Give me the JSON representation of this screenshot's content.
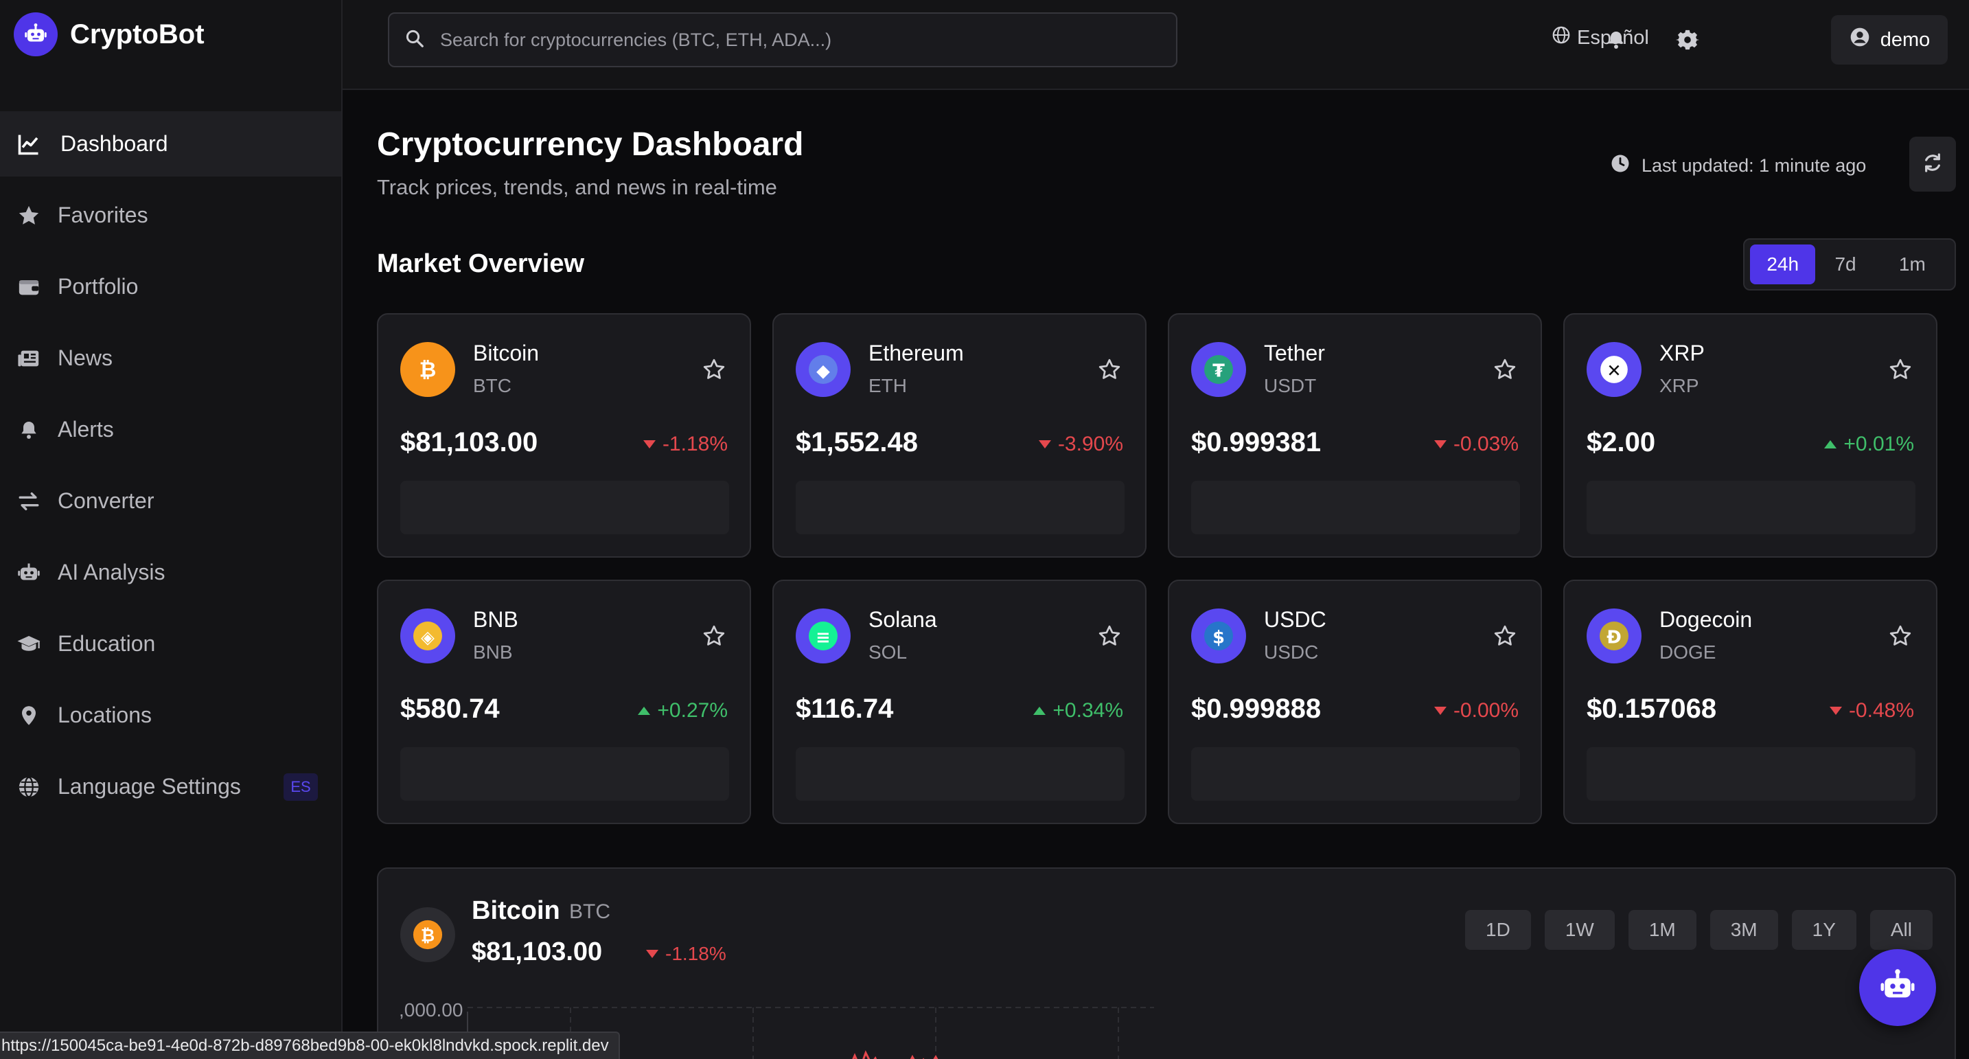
{
  "app": {
    "name": "CryptoBot"
  },
  "sidebar": {
    "items": [
      {
        "label": "Dashboard",
        "icon": "chart-line-icon",
        "active": true
      },
      {
        "label": "Favorites",
        "icon": "star-icon"
      },
      {
        "label": "Portfolio",
        "icon": "wallet-icon"
      },
      {
        "label": "News",
        "icon": "newspaper-icon"
      },
      {
        "label": "Alerts",
        "icon": "bell-icon"
      },
      {
        "label": "Converter",
        "icon": "exchange-icon"
      },
      {
        "label": "AI Analysis",
        "icon": "robot-icon"
      },
      {
        "label": "Education",
        "icon": "graduation-cap-icon"
      },
      {
        "label": "Locations",
        "icon": "map-pin-icon"
      },
      {
        "label": "Language Settings",
        "icon": "globe-icon",
        "badge": "ES"
      }
    ]
  },
  "topbar": {
    "search_placeholder": "Search for cryptocurrencies (BTC, ETH, ADA...)",
    "language": "Español",
    "user": "demo"
  },
  "header": {
    "title": "Cryptocurrency Dashboard",
    "subtitle": "Track prices, trends, and news in real-time",
    "last_updated": "Last updated: 1 minute ago"
  },
  "market": {
    "title": "Market Overview",
    "ranges": [
      "24h",
      "7d",
      "1m"
    ],
    "active_range": "24h",
    "cards": [
      {
        "name": "Bitcoin",
        "symbol": "BTC",
        "price": "$81,103.00",
        "change": "-1.18%",
        "direction": "down",
        "color": "#f7931a",
        "glyph": "₿"
      },
      {
        "name": "Ethereum",
        "symbol": "ETH",
        "price": "$1,552.48",
        "change": "-3.90%",
        "direction": "down",
        "color": "#627eea",
        "glyph": "◆"
      },
      {
        "name": "Tether",
        "symbol": "USDT",
        "price": "$0.999381",
        "change": "-0.03%",
        "direction": "down",
        "color": "#26a17b",
        "glyph": "₮"
      },
      {
        "name": "XRP",
        "symbol": "XRP",
        "price": "$2.00",
        "change": "+0.01%",
        "direction": "up",
        "color": "#ffffff",
        "glyph": "✕"
      },
      {
        "name": "BNB",
        "symbol": "BNB",
        "price": "$580.74",
        "change": "+0.27%",
        "direction": "up",
        "color": "#f3ba2f",
        "glyph": "◈"
      },
      {
        "name": "Solana",
        "symbol": "SOL",
        "price": "$116.74",
        "change": "+0.34%",
        "direction": "up",
        "color": "#14f195",
        "glyph": "≡"
      },
      {
        "name": "USDC",
        "symbol": "USDC",
        "price": "$0.999888",
        "change": "-0.00%",
        "direction": "down",
        "color": "#2775ca",
        "glyph": "$"
      },
      {
        "name": "Dogecoin",
        "symbol": "DOGE",
        "price": "$0.157068",
        "change": "-0.48%",
        "direction": "down",
        "color": "#c2a633",
        "glyph": "Ð"
      }
    ]
  },
  "chart_panel": {
    "name": "Bitcoin",
    "symbol": "BTC",
    "price": "$81,103.00",
    "change": "-1.18%",
    "timeframes": [
      "1D",
      "1W",
      "1M",
      "3M",
      "1Y",
      "All"
    ],
    "y_tick": ",000.00"
  },
  "status_url": "https://150045ca-be91-4e0d-872b-d89768bed9b8-00-ek0kl8lndvkd.spock.replit.dev",
  "colors": {
    "accent": "#4f35e8",
    "down": "#e5484d",
    "up": "#3fbf6a"
  }
}
